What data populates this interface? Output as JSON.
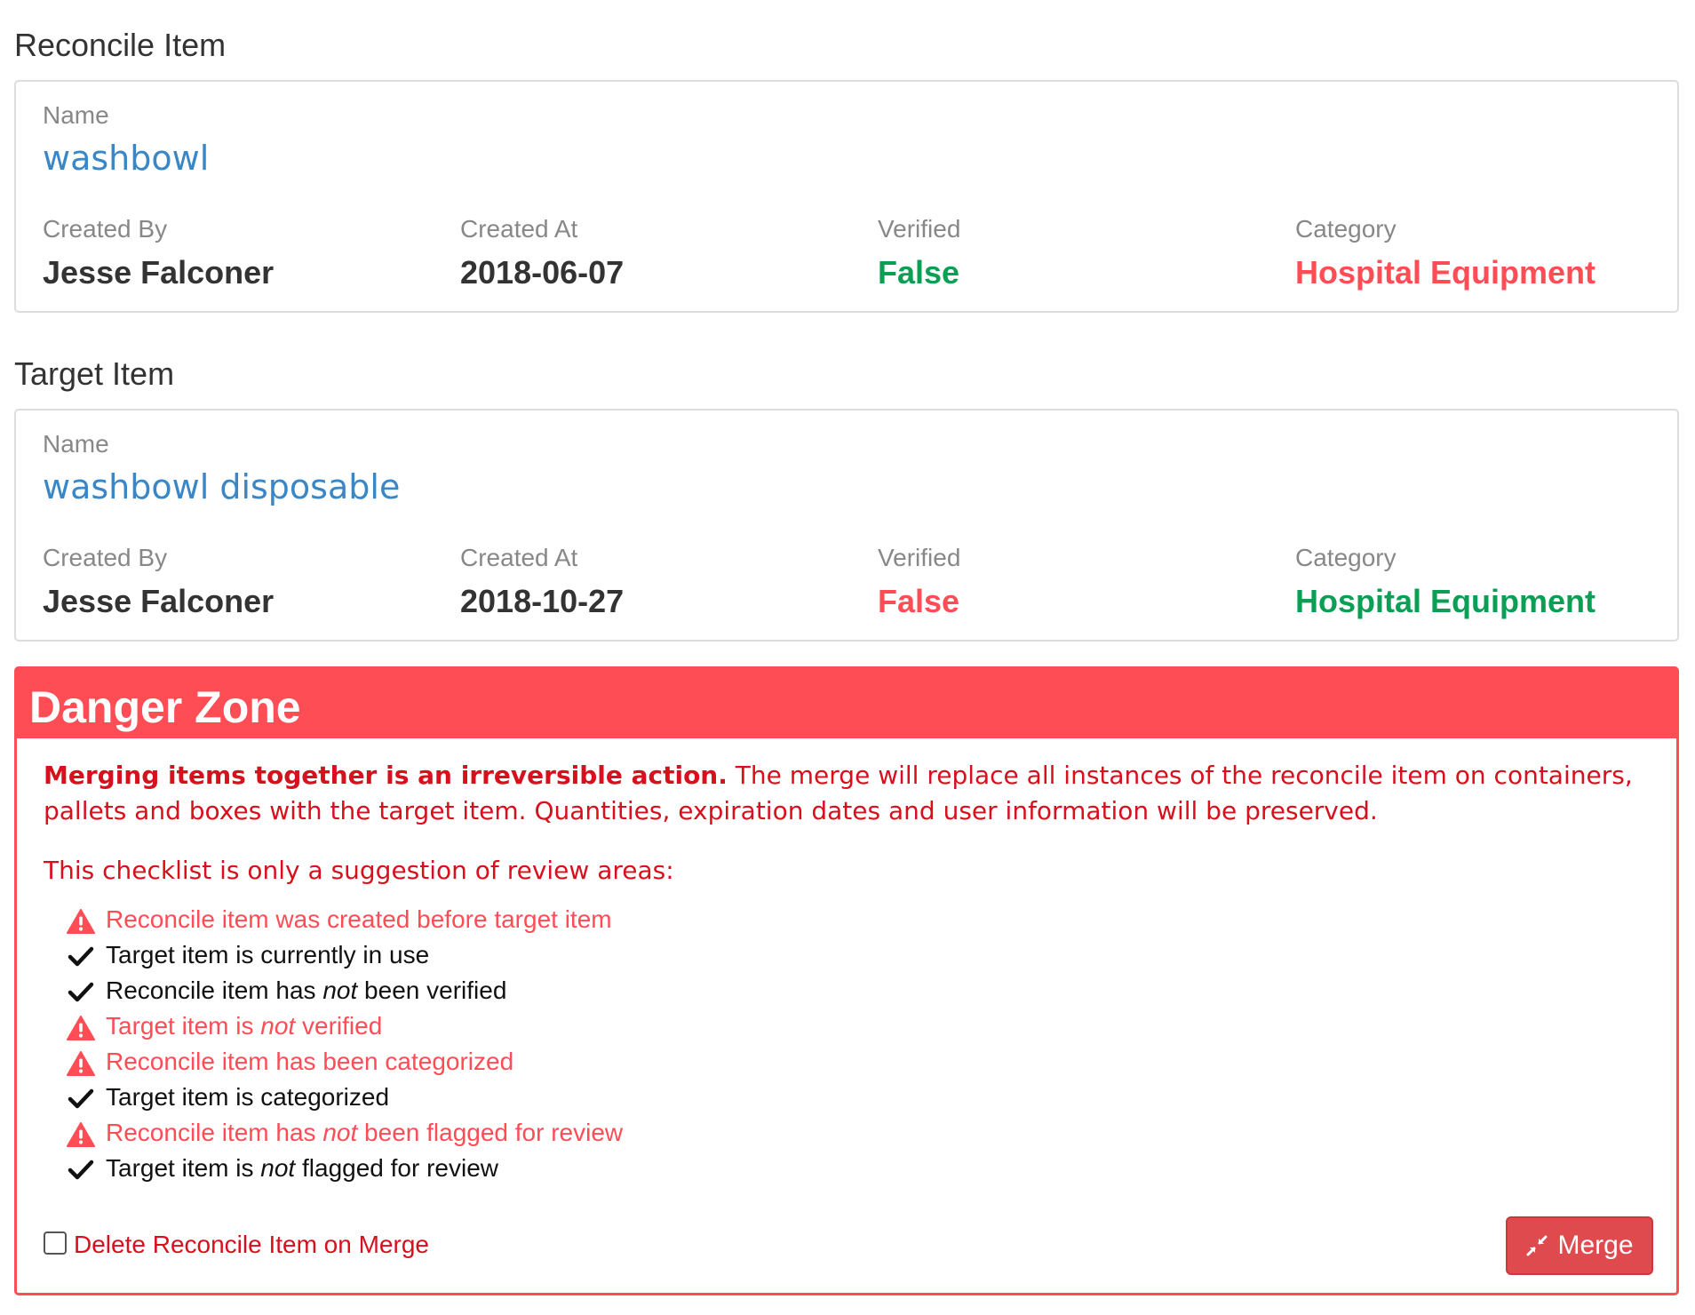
{
  "reconcile": {
    "title": "Reconcile Item",
    "name_label": "Name",
    "name": "washbowl",
    "created_by_label": "Created By",
    "created_by": "Jesse Falconer",
    "created_at_label": "Created At",
    "created_at": "2018-06-07",
    "verified_label": "Verified",
    "verified": "False",
    "category_label": "Category",
    "category": "Hospital Equipment"
  },
  "target": {
    "title": "Target Item",
    "name_label": "Name",
    "name": "washbowl disposable",
    "created_by_label": "Created By",
    "created_by": "Jesse Falconer",
    "created_at_label": "Created At",
    "created_at": "2018-10-27",
    "verified_label": "Verified",
    "verified": "False",
    "category_label": "Category",
    "category": "Hospital Equipment"
  },
  "danger": {
    "title": "Danger Zone",
    "warning_bold": "Merging items together is an irreversible action.",
    "warning_rest": " The merge will replace all instances of the reconcile item on containers, pallets and boxes with the target item. Quantities, expiration dates and user information will be preserved.",
    "checklist_intro": "This checklist is only a suggestion of review areas:",
    "checklist": [
      {
        "status": "warning",
        "icon": "warning-icon",
        "pre": "Reconcile item was created before target item",
        "em": "",
        "post": ""
      },
      {
        "status": "ok",
        "icon": "check-icon",
        "pre": "Target item is currently in use",
        "em": "",
        "post": ""
      },
      {
        "status": "ok",
        "icon": "check-icon",
        "pre": "Reconcile item has ",
        "em": "not",
        "post": " been verified"
      },
      {
        "status": "warning",
        "icon": "warning-icon",
        "pre": "Target item is ",
        "em": "not",
        "post": " verified"
      },
      {
        "status": "warning",
        "icon": "warning-icon",
        "pre": "Reconcile item has been categorized",
        "em": "",
        "post": ""
      },
      {
        "status": "ok",
        "icon": "check-icon",
        "pre": "Target item is categorized",
        "em": "",
        "post": ""
      },
      {
        "status": "warning",
        "icon": "warning-icon",
        "pre": "Reconcile item has ",
        "em": "not",
        "post": " been flagged for review"
      },
      {
        "status": "ok",
        "icon": "check-icon",
        "pre": "Target item is ",
        "em": "not",
        "post": " flagged for review"
      }
    ],
    "delete_checkbox_label": "Delete Reconcile Item on Merge",
    "delete_checked": false,
    "merge_label": "Merge"
  },
  "colors": {
    "link_blue": "#3a87c8",
    "success_green": "#0a9f55",
    "danger_red": "#ff4d55",
    "text_red": "#d8101e"
  }
}
